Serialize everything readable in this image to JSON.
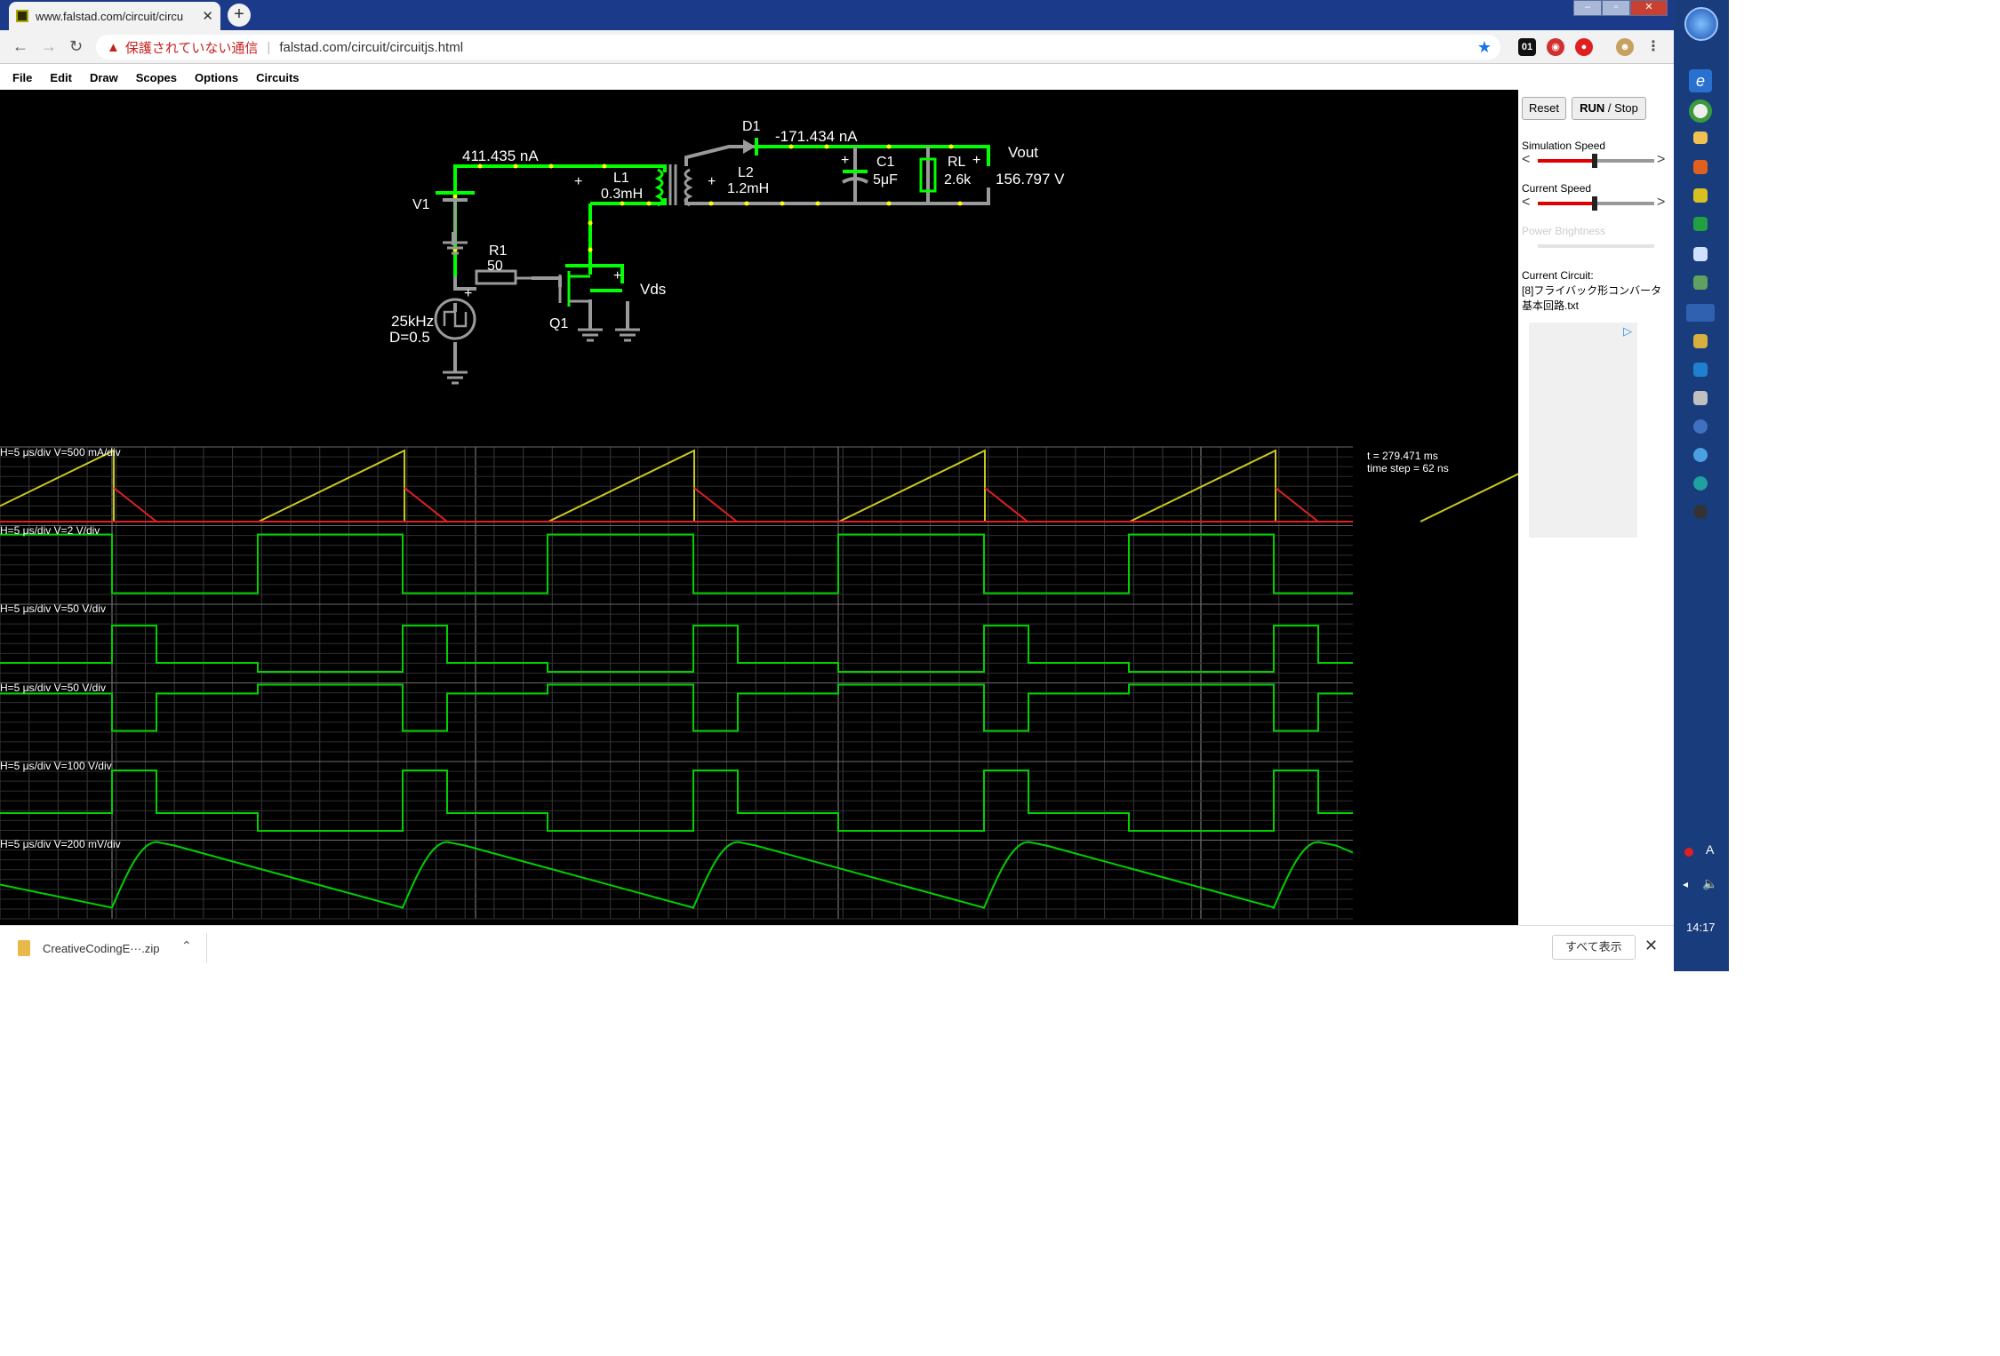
{
  "browser": {
    "tab_title": "www.falstad.com/circuit/circu",
    "security_label": "保護されていない通信",
    "url": "falstad.com/circuit/circuitjs.html"
  },
  "menu": [
    "File",
    "Edit",
    "Draw",
    "Scopes",
    "Options",
    "Circuits"
  ],
  "sidebar": {
    "reset_label": "Reset",
    "run_label": "RUN",
    "stop_label": " / Stop",
    "simulation_speed_label": "Simulation Speed",
    "simulation_speed_value": 0.45,
    "current_speed_label": "Current Speed",
    "current_speed_value": 0.45,
    "power_brightness_label": "Power Brightness",
    "current_circuit_label": "Current Circuit:",
    "current_circuit_name": "[8]フライバック形コンバータ基本回路.txt"
  },
  "circuit": {
    "current_left": "411.435 nA",
    "current_right": "-171.434 nA",
    "d1_label": "D1",
    "l1_label": "L1",
    "l1_value": "0.3mH",
    "l2_label": "L2",
    "l2_value": "1.2mH",
    "c1_label": "C1",
    "c1_value": "5μF",
    "rl_label": "RL",
    "rl_value": "2.6k",
    "vout_label": "Vout",
    "vout_value": "156.797 V",
    "v1_label": "V1",
    "r1_label": "R1",
    "r1_value": "50",
    "source_freq": "25kHz",
    "source_duty": "D=0.5",
    "q1_label": "Q1",
    "vds_label": "Vds",
    "plus": "+"
  },
  "scopes": {
    "labels": [
      "H=5 μs/div V=500 mA/div",
      "H=5 μs/div V=2 V/div",
      "H=5 μs/div V=50 V/div",
      "H=5 μs/div V=50 V/div",
      "H=5 μs/div V=100 V/div",
      "H=5 μs/div V=200 mV/div"
    ],
    "time": "t = 279.471 ms",
    "timestep": "time step = 62 ns"
  },
  "downloads": {
    "file_name": "CreativeCodingE···.zip",
    "show_all": "すべて表示"
  },
  "taskbar": {
    "clock": "14:17",
    "ime": "A"
  },
  "colors": {
    "wire_active": "#00ff00",
    "trace_yellow": "#c8c820",
    "trace_red": "#e02020",
    "trace_green": "#00d000",
    "grid": "#3a3a3a",
    "taskbar": "#183c7c"
  }
}
